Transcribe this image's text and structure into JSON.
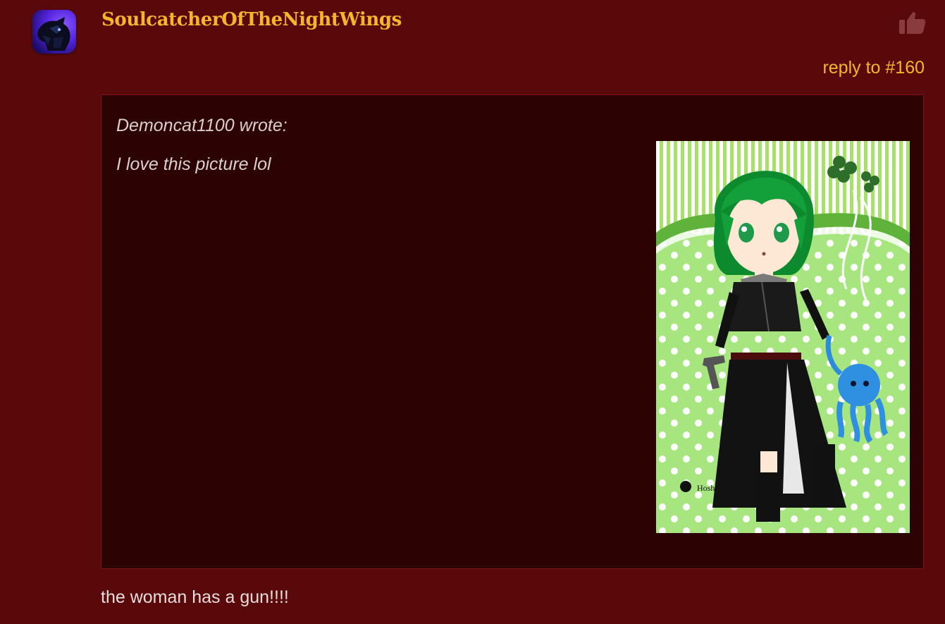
{
  "post": {
    "username": "SoulcatcherOfTheNightWings",
    "avatar_icon": "avatar-image",
    "like_icon": "thumbs-up-icon",
    "reply_label": "reply to #160",
    "body": "the woman has a gun!!!!"
  },
  "quote": {
    "author": "Demoncat1100 wrote:",
    "text": "I love this picture lol",
    "image": {
      "description_icon": "anime-character-image",
      "watermark": "Hoshi Style"
    }
  },
  "colors": {
    "background": "#5a090b",
    "quote_background": "#2d0203",
    "accent": "#f7b62a",
    "quote_text": "#d9cfcf"
  }
}
